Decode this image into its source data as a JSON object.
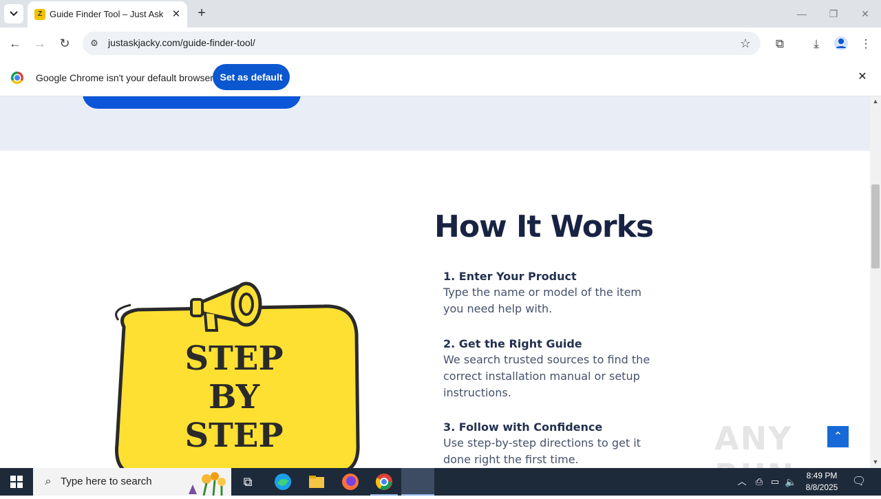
{
  "browser": {
    "tab_title": "Guide Finder Tool – Just Ask Jac",
    "favicon_letter": "Z",
    "url": "justaskjacky.com/guide-finder-tool/"
  },
  "infobar": {
    "message": "Google Chrome isn't your default browser",
    "button": "Set as default"
  },
  "page": {
    "section_title": "How It Works",
    "steps": [
      {
        "heading": "1. Enter Your Product",
        "text": "Type the name or model of the item you need help with."
      },
      {
        "heading": "2. Get the Right Guide",
        "text": "We search trusted sources to find the correct installation manual or setup instructions."
      },
      {
        "heading": "3. Follow with Confidence",
        "text": "Use step-by-step directions to get it done right the first time."
      }
    ],
    "illustration_text": [
      "STEP",
      "BY",
      "STEP"
    ],
    "watermark": "ANY RUN"
  },
  "taskbar": {
    "search_placeholder": "Type here to search",
    "time": "8:49 PM",
    "date": "8/8/2025"
  },
  "colors": {
    "accent_blue": "#0b57d0",
    "title_navy": "#182343",
    "sticker_yellow": "#fde031"
  }
}
